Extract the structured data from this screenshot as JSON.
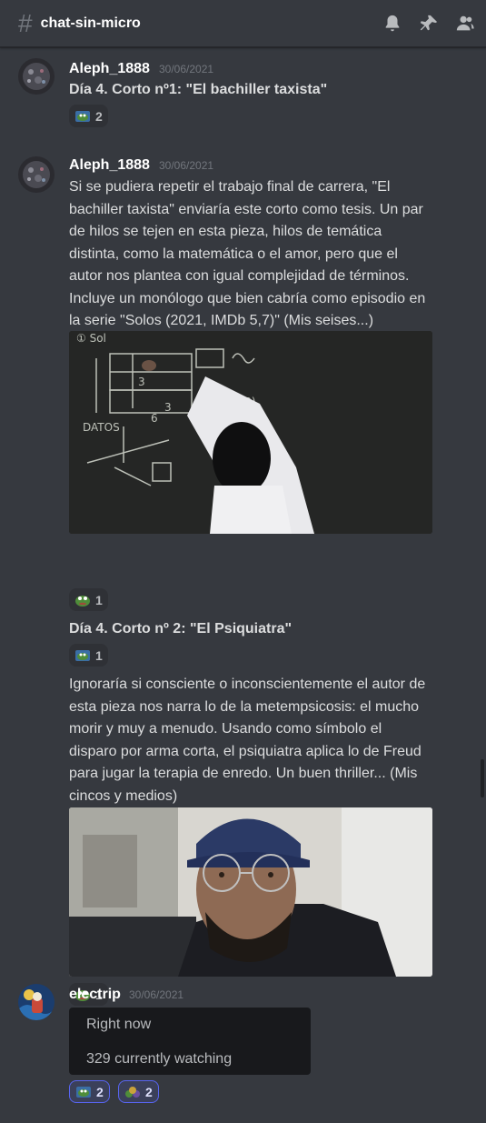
{
  "header": {
    "channel_name": "chat-sin-micro",
    "hash_icon": "#",
    "icons": [
      "bell-icon",
      "pin-icon",
      "members-icon"
    ]
  },
  "messages": [
    {
      "author": "Aleph_1888",
      "timestamp": "30/06/2021",
      "text": "Día 4. Corto nº1: \"El bachiller taxista\"",
      "reaction_count": "2",
      "reaction_emoji": "pepe-tv-emoji"
    },
    {
      "author": "Aleph_1888",
      "timestamp": "30/06/2021",
      "text": "Si se pudiera repetir el trabajo final de carrera, \"El bachiller taxista\" enviaría este corto como tesis. Un par de hilos se tejen en esta pieza, hilos de temática distinta, como la matemática o el amor, pero que el autor nos plantea con igual complejidad de términos.  Incluye un monólogo que bien cabría como episodio en la serie \"Solos (2021, IMDb 5,7)\" (Mis seises...)",
      "image1_alt": "blackboard-math-image",
      "reaction_count": "1",
      "reaction_emoji": "pepe-emoji",
      "followup_title": "Día 4. Corto nº 2: \"El Psiquiatra\"",
      "followup_reaction_count": "1",
      "followup_text": "Ignoraría si consciente o inconscientemente el autor de esta pieza nos narra lo de la metempsicosis: el mucho morir y muy a menudo. Usando como símbolo el disparo por arma corta, el psiquiatra aplica lo de Freud para jugar la terapia de enredo. Un buen thriller... (Mis cincos y medios)",
      "image2_alt": "man-with-cap-image",
      "followup2_reaction_count": "1"
    },
    {
      "author": "electrip",
      "timestamp": "30/06/2021",
      "embed_line1": "Right now",
      "embed_line2": "329 currently watching",
      "reaction1_count": "2",
      "reaction2_count": "2"
    }
  ],
  "colors": {
    "background": "#36393f",
    "username": "#ffffff",
    "timestamp": "#72767d",
    "text": "#dcddde",
    "embed_bg": "#18191c",
    "reaction_active_border": "#5865f2"
  }
}
